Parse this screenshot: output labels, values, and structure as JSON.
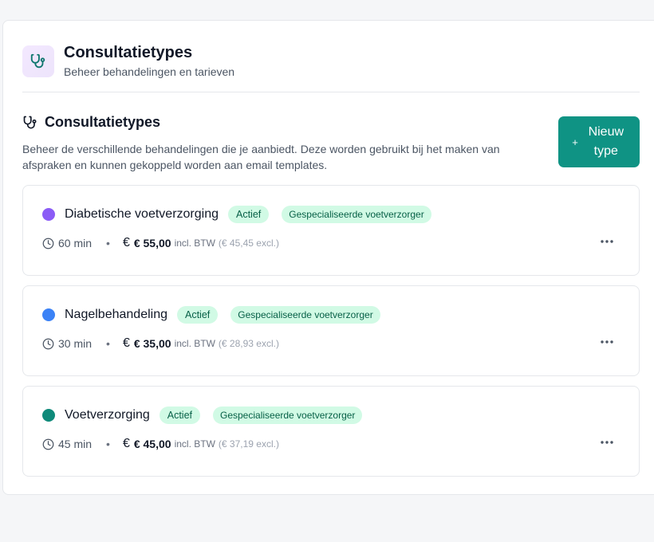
{
  "header": {
    "title": "Consultatietypes",
    "subtitle": "Beheer behandelingen en tarieven",
    "icon": "stethoscope-icon",
    "icon_bg": "#f3e8ff",
    "icon_color": "#0f766e"
  },
  "section": {
    "title": "Consultatietypes",
    "icon": "stethoscope-icon",
    "description": "Beheer de verschillende behandelingen die je aanbiedt. Deze worden gebruikt bij het maken van afspraken en kunnen gekoppeld worden aan email templates."
  },
  "new_button": {
    "icon": "plus-icon",
    "label": "Nieuw type",
    "color": "#0f9384"
  },
  "types": [
    {
      "name": "Diabetische voetverzorging",
      "color": "#8b5cf6",
      "status": "Actief",
      "specialist": "Gespecialiseerde voetverzorger",
      "duration": "60 min",
      "price": "€ 55,00",
      "incl": "incl. BTW",
      "excl": "(€ 45,45 excl.)"
    },
    {
      "name": "Nagelbehandeling",
      "color": "#3b82f6",
      "status": "Actief",
      "specialist": "Gespecialiseerde voetverzorger",
      "duration": "30 min",
      "price": "€ 35,00",
      "incl": "incl. BTW",
      "excl": "(€ 28,93 excl.)"
    },
    {
      "name": "Voetverzorging",
      "color": "#0f8a7a",
      "status": "Actief",
      "specialist": "Gespecialiseerde voetverzorger",
      "duration": "45 min",
      "price": "€ 45,00",
      "incl": "incl. BTW",
      "excl": "(€ 37,19 excl.)"
    }
  ],
  "icons": {
    "clock": "clock-icon",
    "euro": "euro-icon",
    "more": "more-horizontal-icon"
  }
}
